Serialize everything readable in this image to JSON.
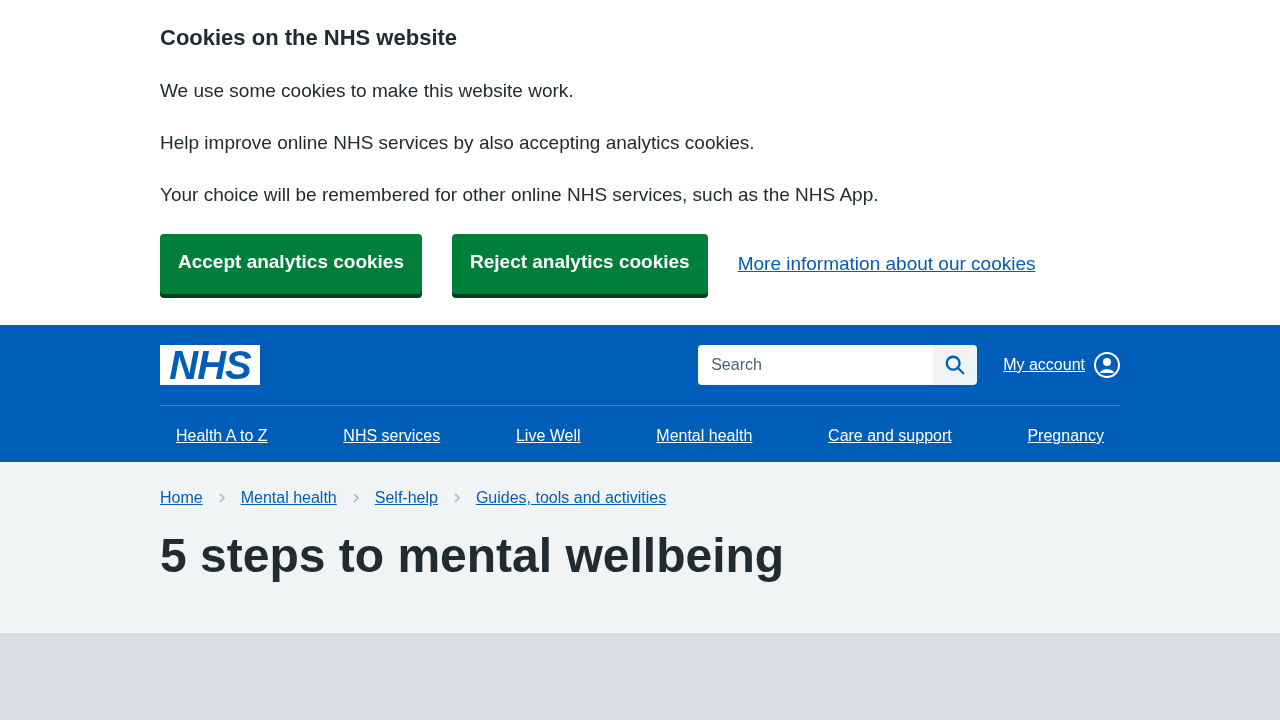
{
  "cookie_banner": {
    "title": "Cookies on the NHS website",
    "paragraphs": [
      "We use some cookies to make this website work.",
      "Help improve online NHS services by also accepting analytics cookies.",
      "Your choice will be remembered for other online NHS services, such as the NHS App."
    ],
    "buttons": [
      "Accept analytics cookies",
      "Reject analytics cookies"
    ],
    "link": "More information about our cookies"
  },
  "header": {
    "logo": "NHS",
    "search": {
      "placeholder": "Search"
    },
    "account": "My account",
    "nav": [
      "Health A to Z",
      "NHS services",
      "Live Well",
      "Mental health",
      "Care and support",
      "Pregnancy"
    ]
  },
  "breadcrumbs": [
    "Home",
    "Mental health",
    "Self-help",
    "Guides, tools and activities"
  ],
  "page_title": "5 steps to mental wellbeing"
}
